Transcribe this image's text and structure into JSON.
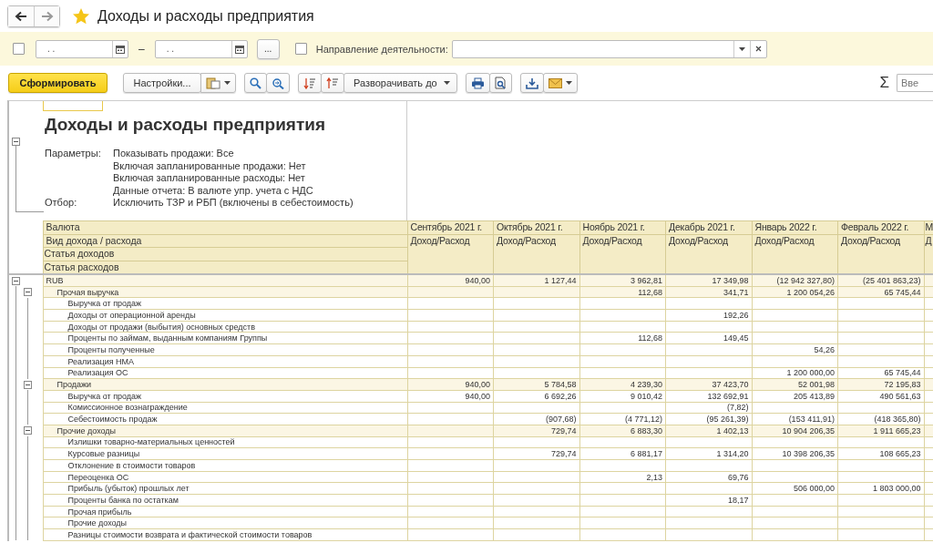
{
  "window": {
    "title": "Доходы и расходы предприятия",
    "favorite": true
  },
  "filters": {
    "period_enabled": false,
    "date_from": ". .",
    "dash": "–",
    "date_to": ". .",
    "period_button": "...",
    "direction_enabled": false,
    "direction_label": "Направление деятельности:"
  },
  "toolbar": {
    "generate": "Сформировать",
    "settings": "Настройки...",
    "expand_to": "Разворачивать до",
    "sum": "Σ",
    "search_placeholder": "Вве"
  },
  "report": {
    "title": "Доходы и расходы предприятия",
    "parameters": [
      {
        "label": "Параметры:",
        "value": "Показывать продажи: Все"
      },
      {
        "value": "Включая запланированные продажи: Нет"
      },
      {
        "value": "Включая запланированные расходы: Нет"
      },
      {
        "value": "Данные отчета: В валюте упр. учета с НДС"
      },
      {
        "label": "Отбор:",
        "value": "Исключить ТЗР и РБП (включены в себестоимость)"
      }
    ],
    "header_labels": [
      "Валюта",
      "Вид дохода / расхода",
      "Статья доходов",
      "Статья расходов"
    ],
    "columns": [
      {
        "month": "Сентябрь 2021 г.",
        "subtitle": "Доход/Расход"
      },
      {
        "month": "Октябрь 2021 г.",
        "subtitle": "Доход/Расход"
      },
      {
        "month": "Ноябрь 2021 г.",
        "subtitle": "Доход/Расход"
      },
      {
        "month": "Декабрь 2021 г.",
        "subtitle": "Доход/Расход"
      },
      {
        "month": "Январь 2022 г.",
        "subtitle": "Доход/Расход"
      },
      {
        "month": "Февраль 2022 г.",
        "subtitle": "Доход/Расход"
      },
      {
        "month": "М",
        "subtitle": "Д"
      }
    ],
    "rows": [
      {
        "label": "RUB",
        "expanded": true,
        "values": [
          {
            "kind": "amount",
            "text": "940,00"
          },
          {
            "kind": "amount",
            "text": "1 127,44"
          },
          {
            "kind": "amount",
            "text": "3 962,81"
          },
          {
            "kind": "amount",
            "text": "17 349,98"
          },
          {
            "kind": "amount",
            "text": "(12 942 327,80)"
          },
          {
            "kind": "amount",
            "text": "(25 401 863,23)"
          }
        ],
        "children": [
          {
            "label": "Прочая выручка",
            "expanded": true,
            "values": [
              {
                "kind": "blank"
              },
              {
                "kind": "blank"
              },
              {
                "kind": "amount",
                "text": "112,68"
              },
              {
                "kind": "amount",
                "text": "341,71"
              },
              {
                "kind": "amount",
                "text": "1 200 054,26"
              },
              {
                "kind": "amount",
                "text": "65 745,44"
              }
            ],
            "children": [
              {
                "label": "Выручка от продаж"
              },
              {
                "label": "Доходы от операционной аренды",
                "values": [
                  {
                    "kind": "blank"
                  },
                  {
                    "kind": "blank"
                  },
                  {
                    "kind": "blank"
                  },
                  {
                    "kind": "amount",
                    "text": "192,26"
                  }
                ]
              },
              {
                "label": "Доходы от продажи (выбытия) основных средств"
              },
              {
                "label": "Проценты по займам, выданным компаниям Группы",
                "values": [
                  {
                    "kind": "blank"
                  },
                  {
                    "kind": "blank"
                  },
                  {
                    "kind": "amount",
                    "text": "112,68"
                  },
                  {
                    "kind": "amount",
                    "text": "149,45"
                  }
                ]
              },
              {
                "label": "Проценты полученные",
                "values": [
                  {
                    "kind": "blank"
                  },
                  {
                    "kind": "blank"
                  },
                  {
                    "kind": "blank"
                  },
                  {
                    "kind": "blank"
                  },
                  {
                    "kind": "amount",
                    "text": "54,26"
                  }
                ]
              },
              {
                "label": "Реализация НМА"
              },
              {
                "label": "Реализация ОС",
                "values": [
                  {
                    "kind": "blank"
                  },
                  {
                    "kind": "blank"
                  },
                  {
                    "kind": "blank"
                  },
                  {
                    "kind": "blank"
                  },
                  {
                    "kind": "amount",
                    "text": "1 200 000,00"
                  },
                  {
                    "kind": "amount",
                    "text": "65 745,44"
                  }
                ]
              }
            ]
          },
          {
            "label": "Продажи",
            "expanded": true,
            "values": [
              {
                "kind": "amount",
                "text": "940,00"
              },
              {
                "kind": "amount",
                "text": "5 784,58"
              },
              {
                "kind": "amount",
                "text": "4 239,30"
              },
              {
                "kind": "amount",
                "text": "37 423,70"
              },
              {
                "kind": "amount",
                "text": "52 001,98"
              },
              {
                "kind": "amount",
                "text": "72 195,83"
              }
            ],
            "children": [
              {
                "label": "Выручка от продаж",
                "values": [
                  {
                    "kind": "amount",
                    "text": "940,00"
                  },
                  {
                    "kind": "amount",
                    "text": "6 692,26"
                  },
                  {
                    "kind": "amount",
                    "text": "9 010,42"
                  },
                  {
                    "kind": "amount",
                    "text": "132 692,91"
                  },
                  {
                    "kind": "amount",
                    "text": "205 413,89"
                  },
                  {
                    "kind": "amount",
                    "text": "490 561,63"
                  }
                ]
              },
              {
                "label": "Комиссионное вознаграждение",
                "values": [
                  {
                    "kind": "blank"
                  },
                  {
                    "kind": "blank"
                  },
                  {
                    "kind": "blank"
                  },
                  {
                    "kind": "amount",
                    "text": "(7,82)"
                  }
                ]
              },
              {
                "label": "Себестоимость продаж",
                "values": [
                  {
                    "kind": "blank"
                  },
                  {
                    "kind": "amount",
                    "text": "(907,68)"
                  },
                  {
                    "kind": "amount",
                    "text": "(4 771,12)"
                  },
                  {
                    "kind": "amount",
                    "text": "(95 261,39)"
                  },
                  {
                    "kind": "amount",
                    "text": "(153 411,91)"
                  },
                  {
                    "kind": "amount",
                    "text": "(418 365,80)"
                  }
                ]
              }
            ]
          },
          {
            "label": "Прочие доходы",
            "expanded": true,
            "values": [
              {
                "kind": "blank"
              },
              {
                "kind": "amount",
                "text": "729,74"
              },
              {
                "kind": "amount",
                "text": "6 883,30"
              },
              {
                "kind": "amount",
                "text": "1 402,13"
              },
              {
                "kind": "amount",
                "text": "10 904 206,35"
              },
              {
                "kind": "amount",
                "text": "1 911 665,23"
              }
            ],
            "children": [
              {
                "label": "Излишки товарно-материальных ценностей"
              },
              {
                "label": "Курсовые разницы",
                "values": [
                  {
                    "kind": "blank"
                  },
                  {
                    "kind": "amount",
                    "text": "729,74"
                  },
                  {
                    "kind": "amount",
                    "text": "6 881,17"
                  },
                  {
                    "kind": "amount",
                    "text": "1 314,20"
                  },
                  {
                    "kind": "amount",
                    "text": "10 398 206,35"
                  },
                  {
                    "kind": "amount",
                    "text": "108 665,23"
                  }
                ]
              },
              {
                "label": "Отклонение в стоимости товаров"
              },
              {
                "label": "Переоценка ОС",
                "values": [
                  {
                    "kind": "blank"
                  },
                  {
                    "kind": "blank"
                  },
                  {
                    "kind": "amount",
                    "text": "2,13"
                  },
                  {
                    "kind": "amount",
                    "text": "69,76"
                  }
                ]
              },
              {
                "label": "Прибыль (убыток) прошлых лет",
                "values": [
                  {
                    "kind": "blank"
                  },
                  {
                    "kind": "blank"
                  },
                  {
                    "kind": "blank"
                  },
                  {
                    "kind": "blank"
                  },
                  {
                    "kind": "amount",
                    "text": "506 000,00"
                  },
                  {
                    "kind": "amount",
                    "text": "1 803 000,00"
                  }
                ]
              },
              {
                "label": "Проценты банка по остаткам",
                "values": [
                  {
                    "kind": "blank"
                  },
                  {
                    "kind": "blank"
                  },
                  {
                    "kind": "blank"
                  },
                  {
                    "kind": "amount",
                    "text": "18,17"
                  }
                ]
              },
              {
                "label": "Прочая прибыль"
              },
              {
                "label": "Прочие доходы"
              },
              {
                "label": "Разницы стоимости возврата и фактической стоимости товаров"
              }
            ]
          }
        ]
      }
    ]
  }
}
